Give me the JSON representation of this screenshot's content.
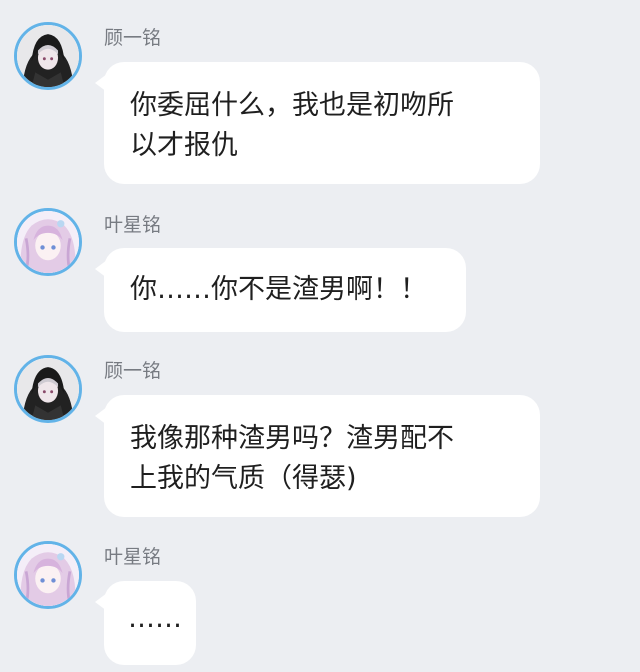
{
  "messages": [
    {
      "sender": "顾一铭",
      "avatar_icon": "dark-hooded-avatar-icon",
      "lines": [
        "你委屈什么，我也是初吻所",
        "以才报仇"
      ]
    },
    {
      "sender": "叶星铭",
      "avatar_icon": "pink-hair-avatar-icon",
      "lines": [
        "你……你不是渣男啊！！"
      ]
    },
    {
      "sender": "顾一铭",
      "avatar_icon": "dark-hooded-avatar-icon",
      "lines": [
        "我像那种渣男吗？渣男配不",
        "上我的气质（得瑟)"
      ]
    },
    {
      "sender": "叶星铭",
      "avatar_icon": "pink-hair-avatar-icon",
      "lines": [
        "……"
      ]
    }
  ],
  "colors": {
    "background": "#eceef2",
    "bubble": "#ffffff",
    "avatar_ring": "#62b3e8",
    "name_text": "#777b82"
  }
}
